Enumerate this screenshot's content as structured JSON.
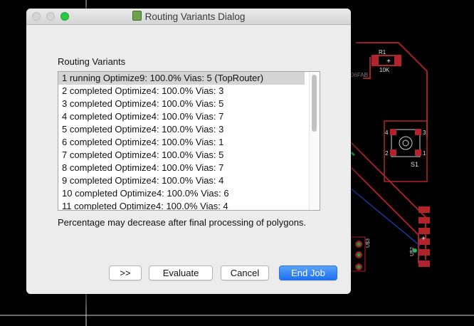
{
  "window": {
    "title": "Routing Variants Dialog"
  },
  "routing_variants": {
    "label": "Routing Variants",
    "items": [
      "1 running Optimize9:  100.0%  Vias: 5 (TopRouter)",
      "2 completed Optimize4:  100.0%  Vias: 3",
      "3 completed Optimize4:  100.0%  Vias: 5",
      "4 completed Optimize4:  100.0%  Vias: 7",
      "5 completed Optimize4:  100.0%  Vias: 3",
      "6 completed Optimize4:  100.0%  Vias: 1",
      "7 completed Optimize4:  100.0%  Vias: 5",
      "8 completed Optimize4:  100.0%  Vias: 7",
      "9 completed Optimize4:  100.0%  Vias: 4",
      "10 completed Optimize4:  100.0%  Vias: 6",
      "11 completed Optimize4:  100.0%  Vias: 4"
    ],
    "note": "Percentage may decrease after final processing of polygons."
  },
  "buttons": {
    "next": ">>",
    "evaluate": "Evaluate",
    "cancel": "Cancel",
    "end_job": "End Job"
  },
  "board_labels": {
    "r1": "R1",
    "r1_value": "10K",
    "s1": "S1",
    "u1": "U$3",
    "u2": "U$2",
    "fab": "06FAB",
    "pin1": "1",
    "pin2": "2",
    "pin3": "3",
    "pin4": "4"
  },
  "colors": {
    "accent": "#1d70f1",
    "board_pad": "#b2242c",
    "board_bg": "#000000"
  }
}
